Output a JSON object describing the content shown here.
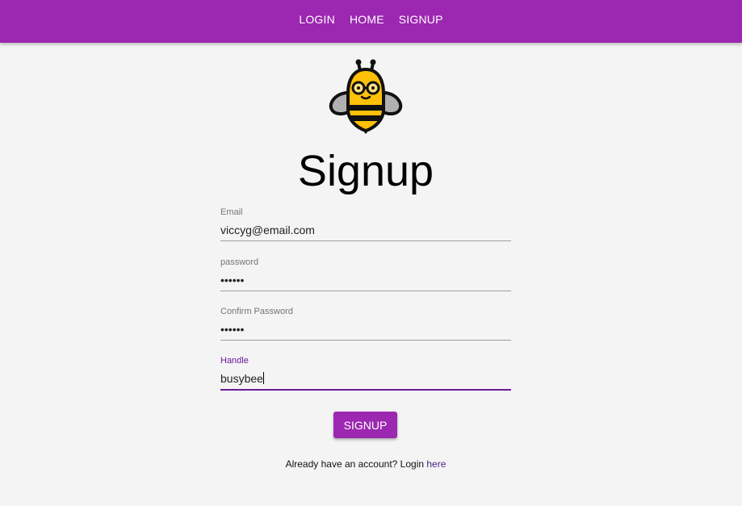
{
  "nav": {
    "items": [
      {
        "label": "LOGIN"
      },
      {
        "label": "HOME"
      },
      {
        "label": "SIGNUP"
      }
    ]
  },
  "logo": {
    "icon": "bee-with-glasses-icon"
  },
  "page": {
    "title": "Signup"
  },
  "form": {
    "email": {
      "label": "Email",
      "value": "viccyg@email.com"
    },
    "password": {
      "label": "password",
      "value": "••••••"
    },
    "confirm_password": {
      "label": "Confirm Password",
      "value": "••••••"
    },
    "handle": {
      "label": "Handle",
      "value": "busybee"
    },
    "submit_label": "SIGNUP"
  },
  "footer": {
    "prompt": "Already have an account? Login ",
    "link_label": "here"
  },
  "colors": {
    "primary": "#9c27b0",
    "focus": "#6a1b9a",
    "background": "#f4f4f4"
  }
}
